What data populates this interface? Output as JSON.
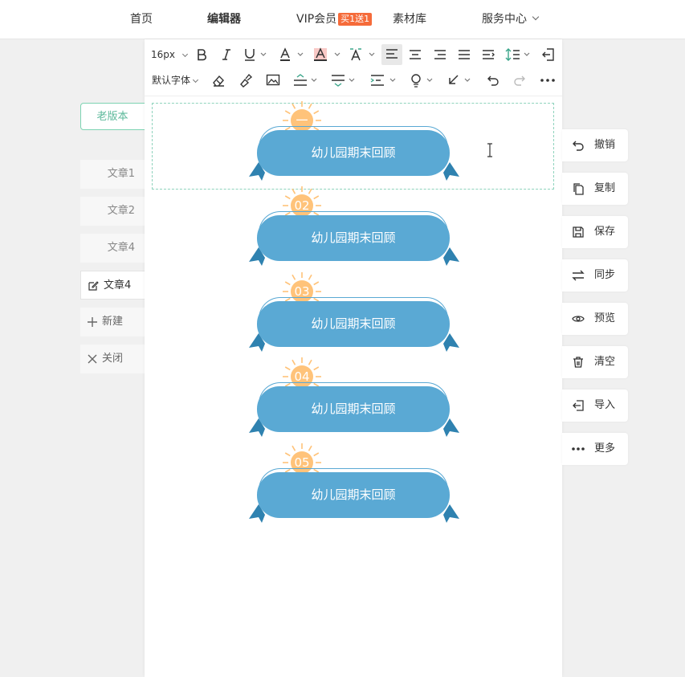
{
  "nav": {
    "home": "首页",
    "editor": "编辑器",
    "vip": "VIP会员",
    "vip_badge": "买1送1",
    "materials": "素材库",
    "service": "服务中心"
  },
  "left": {
    "old_version": "老版本",
    "docs": [
      "文章1",
      "文章2",
      "文章4"
    ],
    "active_doc": "文章4",
    "new": "新建",
    "close": "关闭"
  },
  "toolbar": {
    "font_size": "16px",
    "font_family": "默认字体",
    "icons_row1": [
      "bold-icon",
      "italic-icon",
      "underline-icon",
      "font-color-icon",
      "background-color-icon",
      "clear-format-icon",
      "align-left-icon",
      "align-center-icon",
      "align-right-icon",
      "align-justify-icon",
      "indent-icon",
      "line-height-icon",
      "exit-icon"
    ],
    "icons_row2": [
      "eraser-icon",
      "format-brush-icon",
      "image-icon",
      "paragraph-spacing-before-icon",
      "paragraph-spacing-after-icon",
      "letter-spacing-icon",
      "emoji-icon",
      "link-icon",
      "undo-icon",
      "redo-icon",
      "more-icon"
    ],
    "selected": "align-left-icon"
  },
  "content": {
    "items": [
      {
        "num": "一",
        "text": "幼儿园期末回顾"
      },
      {
        "num": "02",
        "text": "幼儿园期末回顾"
      },
      {
        "num": "03",
        "text": "幼儿园期末回顾"
      },
      {
        "num": "04",
        "text": "幼儿园期末回顾"
      },
      {
        "num": "05",
        "text": "幼儿园期末回顾"
      }
    ],
    "colors": {
      "banner": "#5aa9d4",
      "sun": "#ffc37a",
      "ribbon": "#2f82b0"
    }
  },
  "actions": {
    "undo": "撤销",
    "copy": "复制",
    "save": "保存",
    "sync": "同步",
    "preview": "预览",
    "clear": "清空",
    "import": "导入",
    "more": "更多"
  }
}
